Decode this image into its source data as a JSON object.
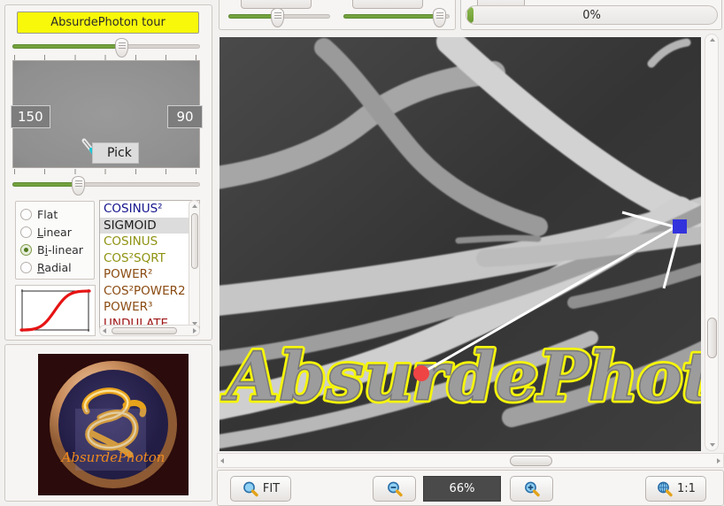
{
  "app": {
    "name": "AbsurdePhoton"
  },
  "left_panel": {
    "tour_button": {
      "label": "AbsurdePhoton tour"
    },
    "top_slider": {
      "value_pct": 58,
      "name": "top-gradient-slider"
    },
    "bottom_slider": {
      "value_pct": 35,
      "name": "bottom-gradient-slider"
    },
    "gradient_preview": {
      "left_value": "150",
      "right_value": "90",
      "pick_button": "Pick"
    },
    "interpolation": {
      "options": [
        {
          "label": "Flat",
          "mnemonic": "",
          "selected": false
        },
        {
          "label": "Linear",
          "mnemonic": "L",
          "selected": false
        },
        {
          "label": "Bi-linear",
          "mnemonic": "i",
          "selected": true
        },
        {
          "label": "Radial",
          "mnemonic": "R",
          "selected": false
        }
      ]
    },
    "curve_preview": {
      "shape": "sigmoid",
      "color": "#e61414"
    },
    "function_list": {
      "items": [
        {
          "label": "COSINUS²",
          "color": "#13138c",
          "selected": false
        },
        {
          "label": "SIGMOID",
          "color": "#1c1c1c",
          "selected": true
        },
        {
          "label": "COSINUS",
          "color": "#8f9211",
          "selected": false
        },
        {
          "label": "COS²SQRT",
          "color": "#8f9211",
          "selected": false
        },
        {
          "label": "POWER²",
          "color": "#8a4b12",
          "selected": false
        },
        {
          "label": "COS²POWER2",
          "color": "#8a4b12",
          "selected": false
        },
        {
          "label": "POWER³",
          "color": "#8a4b12",
          "selected": false
        },
        {
          "label": "UNDULATE",
          "color": "#9e1515",
          "selected": false
        }
      ],
      "scroll_v_pct": 10,
      "scroll_h_pct": 20
    },
    "logo": {
      "caption": "AbsurdePhoton",
      "ring_color": "#c58a5a",
      "disc_color": "#2f2a52",
      "swirl_color": "#f0a820",
      "backdrop_color": "#2b0b0b"
    }
  },
  "top_bar": {
    "slider_a": {
      "value_pct": 48,
      "name": "top-slider-a"
    },
    "slider_b": {
      "value_pct": 90,
      "name": "top-slider-b"
    },
    "progress": {
      "label": "0%",
      "value_pct": 0
    }
  },
  "canvas": {
    "marker": {
      "color": "#3333dd",
      "shape": "square"
    },
    "overlay_text": "AbsurdePhoton",
    "overlay_outline_color": "#f5f50c",
    "overlay_fill_color": "#9c9c9c",
    "background_color": "#3a3a3a",
    "vscroll_pct": 70,
    "hscroll_pct": 58
  },
  "bottom_toolbar": {
    "fit_button": "FIT",
    "zoom_out_button": "",
    "zoom_level": "66%",
    "zoom_in_button": "",
    "one_to_one_button": "1:1"
  }
}
